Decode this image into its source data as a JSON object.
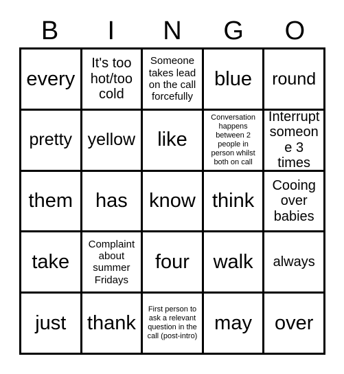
{
  "card": {
    "title_letters": [
      "B",
      "I",
      "N",
      "G",
      "O"
    ],
    "rows": [
      [
        {
          "text": "every",
          "size": "xl"
        },
        {
          "text": "It's too hot/too cold",
          "size": "md"
        },
        {
          "text": "Someone takes lead on the call forcefully",
          "size": "sm"
        },
        {
          "text": "blue",
          "size": "xl"
        },
        {
          "text": "round",
          "size": "lg"
        }
      ],
      [
        {
          "text": "pretty",
          "size": "lg"
        },
        {
          "text": "yellow",
          "size": "lg"
        },
        {
          "text": "like",
          "size": "xl"
        },
        {
          "text": "Conversation happens between 2 people in person whilst both on call",
          "size": "xs"
        },
        {
          "text": "Interrupt someone 3 times",
          "size": "md"
        }
      ],
      [
        {
          "text": "them",
          "size": "xl"
        },
        {
          "text": "has",
          "size": "xl"
        },
        {
          "text": "know",
          "size": "xl"
        },
        {
          "text": "think",
          "size": "xl"
        },
        {
          "text": "Cooing over babies",
          "size": "md"
        }
      ],
      [
        {
          "text": "take",
          "size": "xl"
        },
        {
          "text": "Complaint about summer Fridays",
          "size": "sm"
        },
        {
          "text": "four",
          "size": "xl"
        },
        {
          "text": "walk",
          "size": "xl"
        },
        {
          "text": "always",
          "size": "md"
        }
      ],
      [
        {
          "text": "just",
          "size": "xl"
        },
        {
          "text": "thank",
          "size": "xl"
        },
        {
          "text": "First person to ask a relevant question in the call (post-intro)",
          "size": "xs"
        },
        {
          "text": "may",
          "size": "xl"
        },
        {
          "text": "over",
          "size": "xl"
        }
      ]
    ]
  },
  "colors": {
    "background": "#ffffff",
    "grid_line": "#000000",
    "text": "#000000"
  }
}
